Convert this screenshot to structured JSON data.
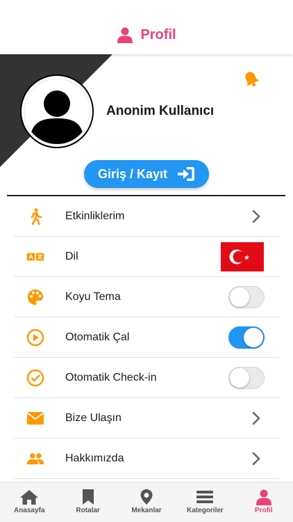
{
  "colors": {
    "accent": "#ec407a",
    "primary_button": "#2196f3",
    "icon_orange": "#ff9800",
    "header_corner": "#333333",
    "tab_inactive": "#555555"
  },
  "navbar": {
    "title": "Profil",
    "icon": "person-icon"
  },
  "profile": {
    "username": "Anonim Kullanıcı",
    "login_button_label": "Giriş / Kayıt",
    "login_icon": "sign-in-icon",
    "notification_icon": "bell-icon"
  },
  "settings": [
    {
      "label": "Etkinliklerim",
      "icon": "walking-icon",
      "control": "chevron"
    },
    {
      "label": "Dil",
      "icon": "translate-icon",
      "control": "flag",
      "flag": "turkey-flag"
    },
    {
      "label": "Koyu Tema",
      "icon": "palette-icon",
      "control": "toggle",
      "on": false
    },
    {
      "label": "Otomatik Çal",
      "icon": "play-circle-icon",
      "control": "toggle",
      "on": true
    },
    {
      "label": "Otomatik Check-in",
      "icon": "check-circle-icon",
      "control": "toggle",
      "on": false
    },
    {
      "label": "Bize Ulaşın",
      "icon": "envelope-icon",
      "control": "chevron"
    },
    {
      "label": "Hakkımızda",
      "icon": "users-icon",
      "control": "chevron"
    }
  ],
  "tabbar": [
    {
      "label": "Anasayfa",
      "icon": "home-icon",
      "active": false
    },
    {
      "label": "Rotalar",
      "icon": "bookmark-icon",
      "active": false
    },
    {
      "label": "Mekanlar",
      "icon": "map-marker-icon",
      "active": false
    },
    {
      "label": "Kategoriler",
      "icon": "menu-lines-icon",
      "active": false
    },
    {
      "label": "Profil",
      "icon": "person-icon",
      "active": true
    }
  ]
}
